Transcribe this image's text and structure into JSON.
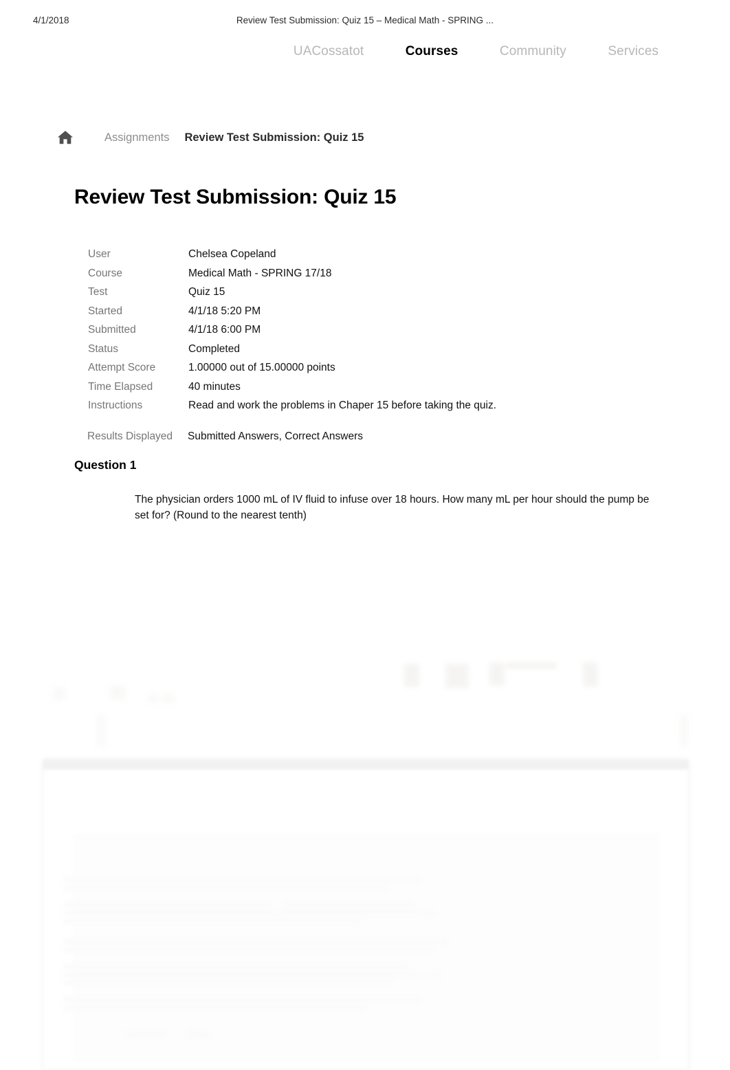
{
  "print_header": {
    "date": "4/1/2018",
    "title": "Review Test Submission: Quiz 15 – Medical Math - SPRING ..."
  },
  "topnav": {
    "items": [
      {
        "label": "UACossatot",
        "active": false
      },
      {
        "label": "Courses",
        "active": true
      },
      {
        "label": "Community",
        "active": false
      },
      {
        "label": "Services",
        "active": false
      }
    ]
  },
  "breadcrumb": {
    "home_icon": "home-icon",
    "items": [
      {
        "label": "Assignments",
        "current": false
      },
      {
        "label": "Review Test Submission: Quiz 15",
        "current": true
      }
    ]
  },
  "page": {
    "title": "Review Test Submission: Quiz 15"
  },
  "info": {
    "rows": [
      {
        "label": "User",
        "value": "Chelsea Copeland"
      },
      {
        "label": "Course",
        "value": "Medical Math - SPRING 17/18"
      },
      {
        "label": "Test",
        "value": "Quiz 15"
      },
      {
        "label": "Started",
        "value": "4/1/18 5:20 PM"
      },
      {
        "label": "Submitted",
        "value": "4/1/18 6:00 PM"
      },
      {
        "label": "Status",
        "value": "Completed"
      },
      {
        "label": "Attempt Score",
        "value": "1.00000 out of 15.00000 points"
      },
      {
        "label": "Time Elapsed",
        "value": "40 minutes"
      },
      {
        "label": "Instructions",
        "value": "Read and work the problems in Chaper 15 before taking the quiz."
      },
      {
        "label": "Results Displayed",
        "value": "Submitted Answers, Correct Answers"
      }
    ]
  },
  "question": {
    "heading": "Question 1",
    "text": "The physician orders 1000 mL of IV fluid to infuse over 18 hours. How many mL per hour should the pump be set for? (Round to the nearest tenth)"
  },
  "colors": {
    "label_gray": "#767676",
    "nav_inactive": "#b7b7b7",
    "text": "#111111",
    "icon_gray": "#4f4f4f"
  }
}
